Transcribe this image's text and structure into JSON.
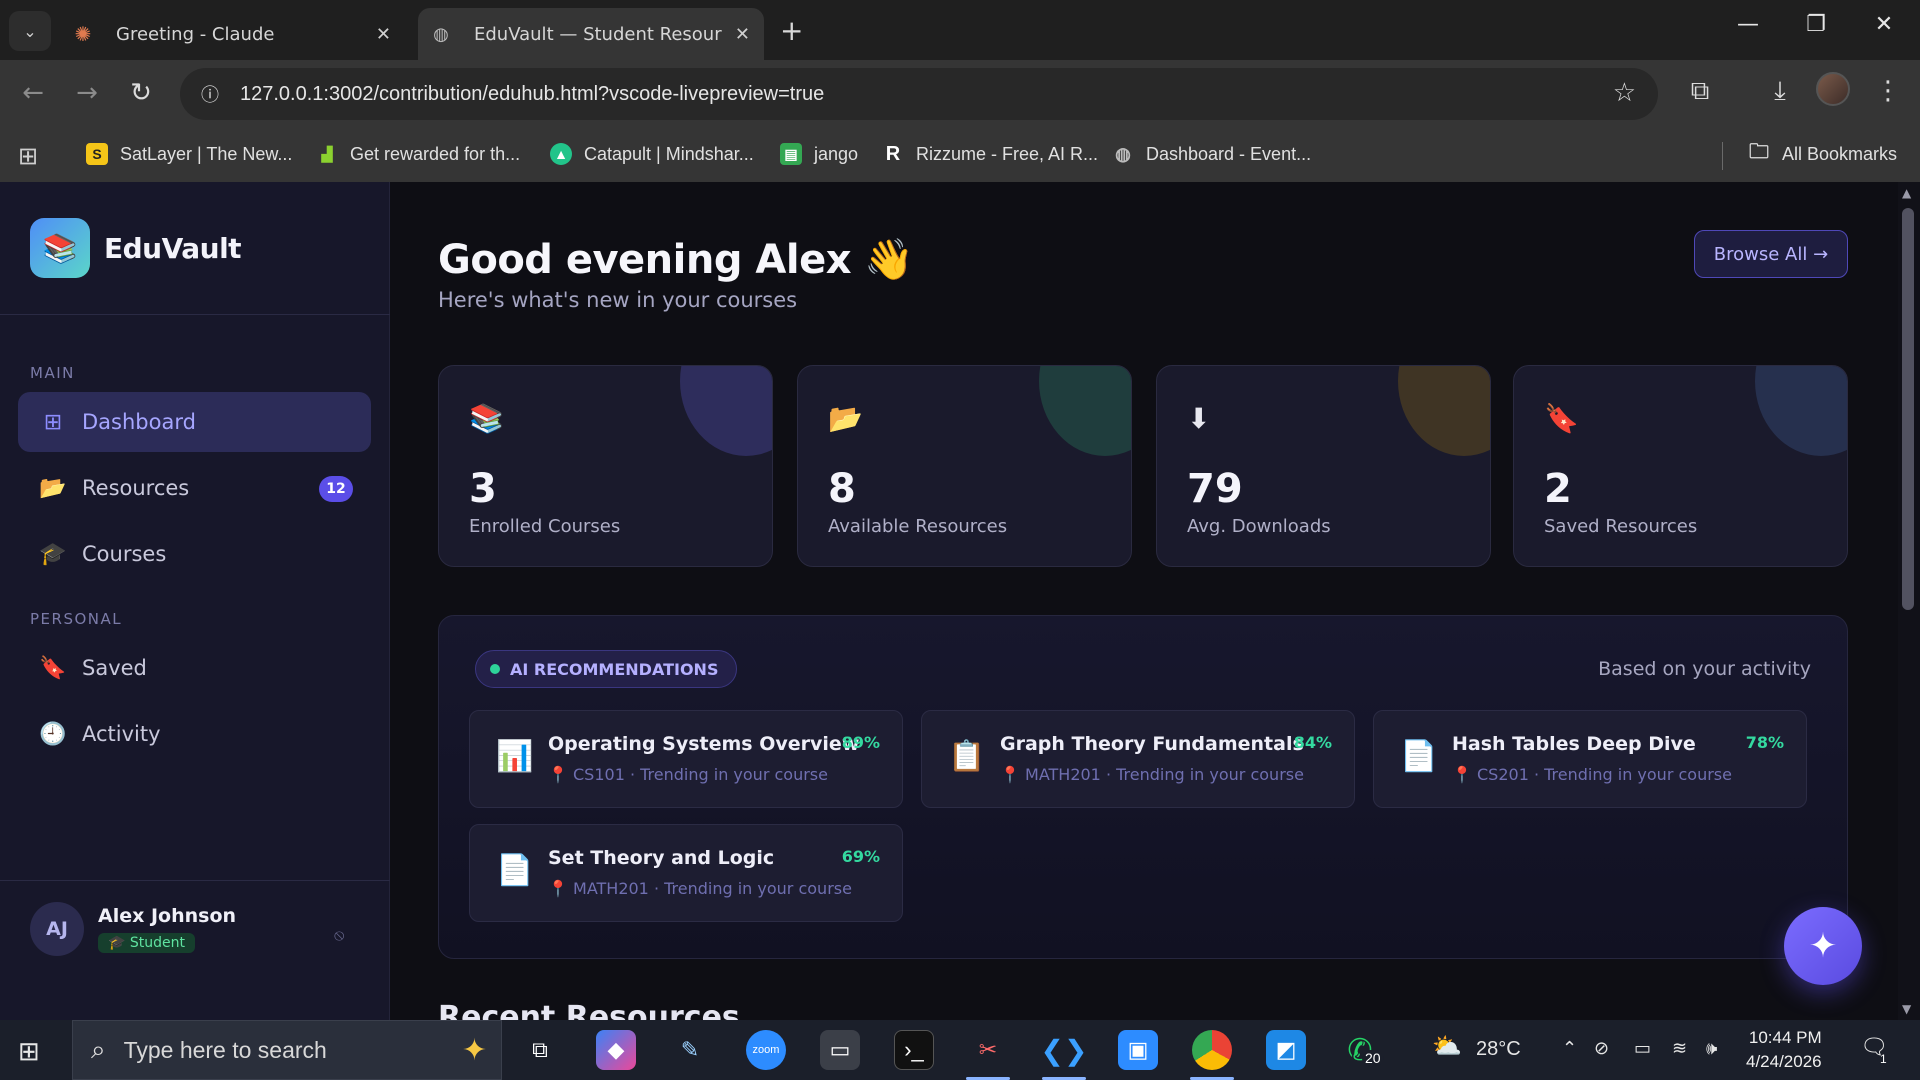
{
  "browser": {
    "tabs": [
      {
        "title": "Greeting - Claude",
        "favicon": "claude-asterisk-icon",
        "active": false
      },
      {
        "title": "EduVault — Student Resource P",
        "favicon": "globe-icon",
        "active": true
      }
    ],
    "url": "127.0.0.1:3002/contribution/eduhub.html?vscode-livepreview=true",
    "bookmarks": [
      {
        "label": "SatLayer | The New...",
        "color": "#f5c518"
      },
      {
        "label": "Get rewarded for th...",
        "color": "#8bd12f"
      },
      {
        "label": "Catapult | Mindshar...",
        "color": "#22c48a"
      },
      {
        "label": "jango",
        "color": "#34a853"
      },
      {
        "label": "Rizzume - Free, AI R...",
        "color": "#ffffff"
      },
      {
        "label": "Dashboard - Event...",
        "color": "#9a9a9a"
      }
    ],
    "all_bookmarks": "All Bookmarks"
  },
  "sidebar": {
    "brand": "EduVault",
    "sections": {
      "main": "MAIN",
      "personal": "PERSONAL"
    },
    "items": [
      {
        "label": "Dashboard",
        "icon": "grid-icon",
        "active": true
      },
      {
        "label": "Resources",
        "icon": "folder-icon",
        "badge": "12"
      },
      {
        "label": "Courses",
        "icon": "graduation-cap-icon"
      },
      {
        "label": "Saved",
        "icon": "bookmark-tag-icon"
      },
      {
        "label": "Activity",
        "icon": "clock-icon"
      }
    ],
    "user": {
      "initials": "AJ",
      "name": "Alex Johnson",
      "role": "🎓 Student"
    }
  },
  "main": {
    "greeting": "Good evening Alex 👋",
    "subtitle": "Here's what's new in your courses",
    "browse_button": "Browse All →",
    "stats": [
      {
        "icon": "📚",
        "value": "3",
        "label": "Enrolled Courses",
        "blob": "#2e2d5c"
      },
      {
        "icon": "📂",
        "value": "8",
        "label": "Available Resources",
        "blob": "#1f3d3d"
      },
      {
        "icon": "⬇",
        "value": "79",
        "label": "Avg. Downloads",
        "blob": "#3f3424"
      },
      {
        "icon": "🔖",
        "value": "2",
        "label": "Saved Resources",
        "blob": "#26304e"
      }
    ],
    "reco": {
      "pill": "AI RECOMMENDATIONS",
      "based_on": "Based on your activity",
      "items": [
        {
          "icon": "📊",
          "title": "Operating Systems Overview",
          "meta": "📍 CS101 · Trending in your course",
          "pct": "89%"
        },
        {
          "icon": "📋",
          "title": "Graph Theory Fundamentals",
          "meta": "📍 MATH201 · Trending in your course",
          "pct": "84%"
        },
        {
          "icon": "📄",
          "title": "Hash Tables Deep Dive",
          "meta": "📍 CS201 · Trending in your course",
          "pct": "78%"
        },
        {
          "icon": "📄",
          "title": "Set Theory and Logic",
          "meta": "📍 MATH201 · Trending in your course",
          "pct": "69%"
        }
      ]
    },
    "recent_heading": "Recent Resources",
    "fab": "✦"
  },
  "taskbar": {
    "search_placeholder": "Type here to search",
    "weather": "28°C",
    "time": "10:44 PM",
    "date": "4/24/2026",
    "whatsapp_badge": "20",
    "notif_count": "1"
  }
}
